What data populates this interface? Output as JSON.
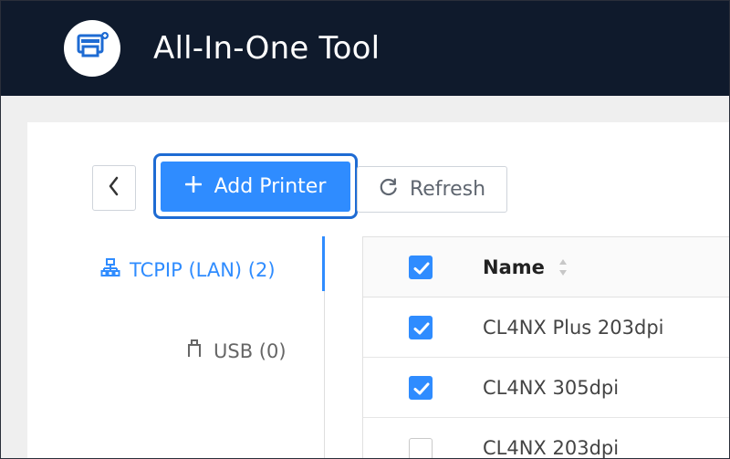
{
  "app": {
    "title": "All-In-One Tool",
    "colors": {
      "header_bg": "#0f1a2c",
      "accent": "#2f8cff",
      "focus_border": "#1e6bd3",
      "content_bg": "#efefef"
    },
    "icons": {
      "logo": "printer-app-icon"
    }
  },
  "toolbar": {
    "back_icon": "chevron-left-icon",
    "add_printer_label": "Add Printer",
    "add_icon": "plus-icon",
    "refresh_label": "Refresh",
    "refresh_icon": "refresh-icon"
  },
  "connections": {
    "tabs": [
      {
        "label": "TCPIP (LAN) (2)",
        "icon": "network-icon",
        "active": true
      },
      {
        "label": "USB (0)",
        "icon": "usb-icon",
        "active": false
      }
    ]
  },
  "printers_table": {
    "header": {
      "select_all_checked": true,
      "name_label": "Name",
      "sort_icon": "sort-icon"
    },
    "rows": [
      {
        "name": "CL4NX Plus 203dpi",
        "checked": true
      },
      {
        "name": "CL4NX 305dpi",
        "checked": true
      },
      {
        "name": "CL4NX 203dpi",
        "checked": false
      }
    ]
  }
}
